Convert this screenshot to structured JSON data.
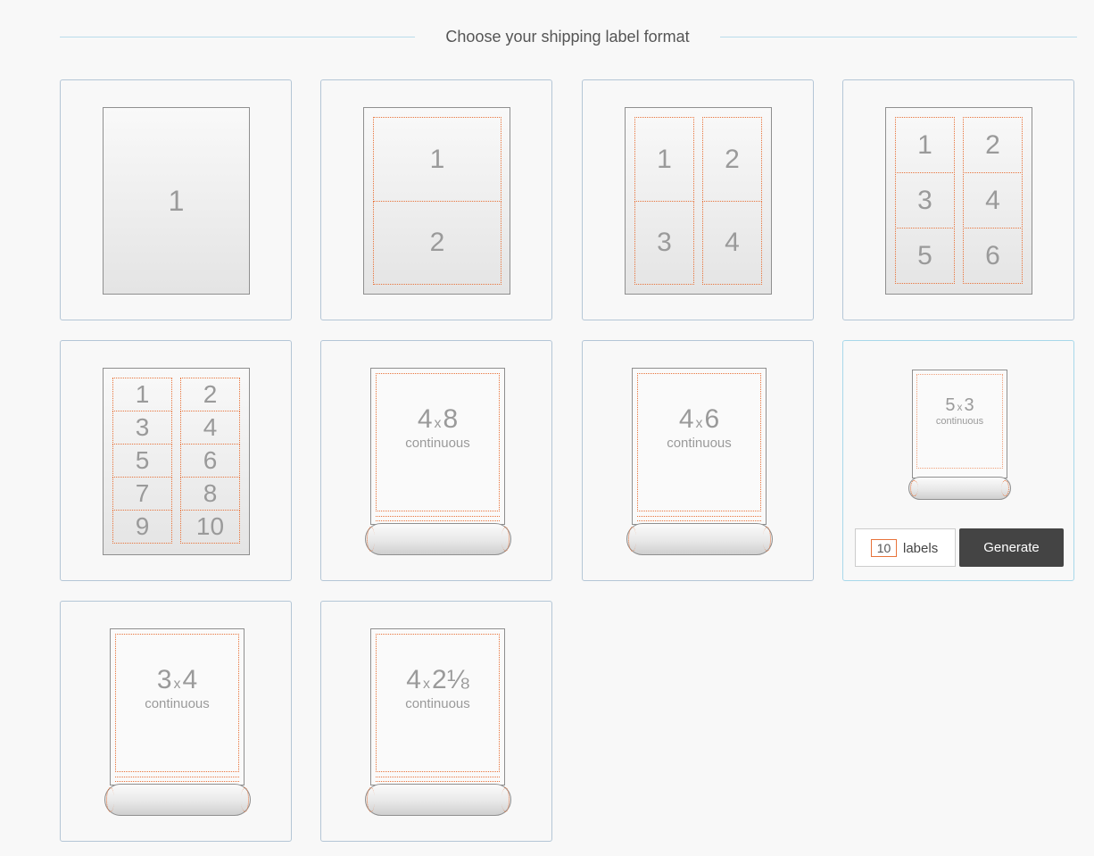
{
  "header": {
    "title": "Choose your shipping label format"
  },
  "formats": {
    "f1": {
      "cells": [
        "1"
      ]
    },
    "f2": {
      "cells": [
        "1",
        "2"
      ]
    },
    "f4": {
      "cells": [
        "1",
        "2",
        "3",
        "4"
      ]
    },
    "f6": {
      "cells": [
        "1",
        "2",
        "3",
        "4",
        "5",
        "6"
      ]
    },
    "f10": {
      "cells": [
        "1",
        "2",
        "3",
        "4",
        "5",
        "6",
        "7",
        "8",
        "9",
        "10"
      ]
    },
    "r4x8": {
      "w": "4",
      "x": "x",
      "h": "8",
      "sub": "continuous"
    },
    "r4x6": {
      "w": "4",
      "x": "x",
      "h": "6",
      "sub": "continuous"
    },
    "r5x3": {
      "w": "5",
      "x": "x",
      "h": "3",
      "sub": "continuous"
    },
    "r3x4": {
      "w": "3",
      "x": "x",
      "h": "4",
      "sub": "continuous"
    },
    "r4x218": {
      "w": "4",
      "x": "x",
      "h": "2⅛",
      "sub": "continuous"
    }
  },
  "controls": {
    "quantity": "10",
    "quantity_label": "labels",
    "generate_label": "Generate"
  },
  "colors": {
    "accent_dots": "#e8733a",
    "button_bg": "#444444",
    "card_border": "#b4c6d6",
    "header_line": "#b9dceb"
  }
}
